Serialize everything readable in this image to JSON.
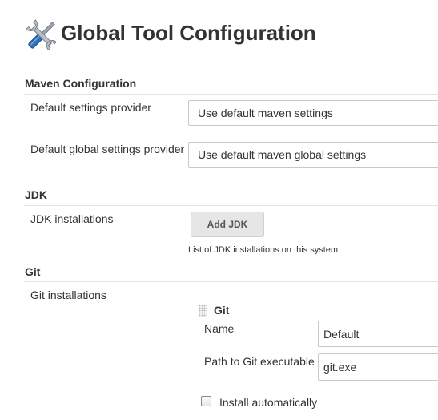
{
  "page": {
    "title": "Global Tool Configuration",
    "title_icon": "tools-icon"
  },
  "maven": {
    "section_title": "Maven Configuration",
    "settings_label": "Default settings provider",
    "settings_value": "Use default maven settings",
    "global_settings_label": "Default global settings provider",
    "global_settings_value": "Use default maven global settings"
  },
  "jdk": {
    "section_title": "JDK",
    "installations_label": "JDK installations",
    "add_button": "Add JDK",
    "help": "List of JDK installations on this system"
  },
  "git": {
    "section_title": "Git",
    "installations_label": "Git installations",
    "entry_title": "Git",
    "name_label": "Name",
    "name_value": "Default",
    "path_label": "Path to Git executable",
    "path_value": "git.exe",
    "install_auto_label": "Install automatically",
    "install_auto_checked": false
  },
  "colors": {
    "accent_blue": "#2f6fb3",
    "button_bg": "#e6e6e6",
    "section_rule": "#e3e3e3"
  }
}
